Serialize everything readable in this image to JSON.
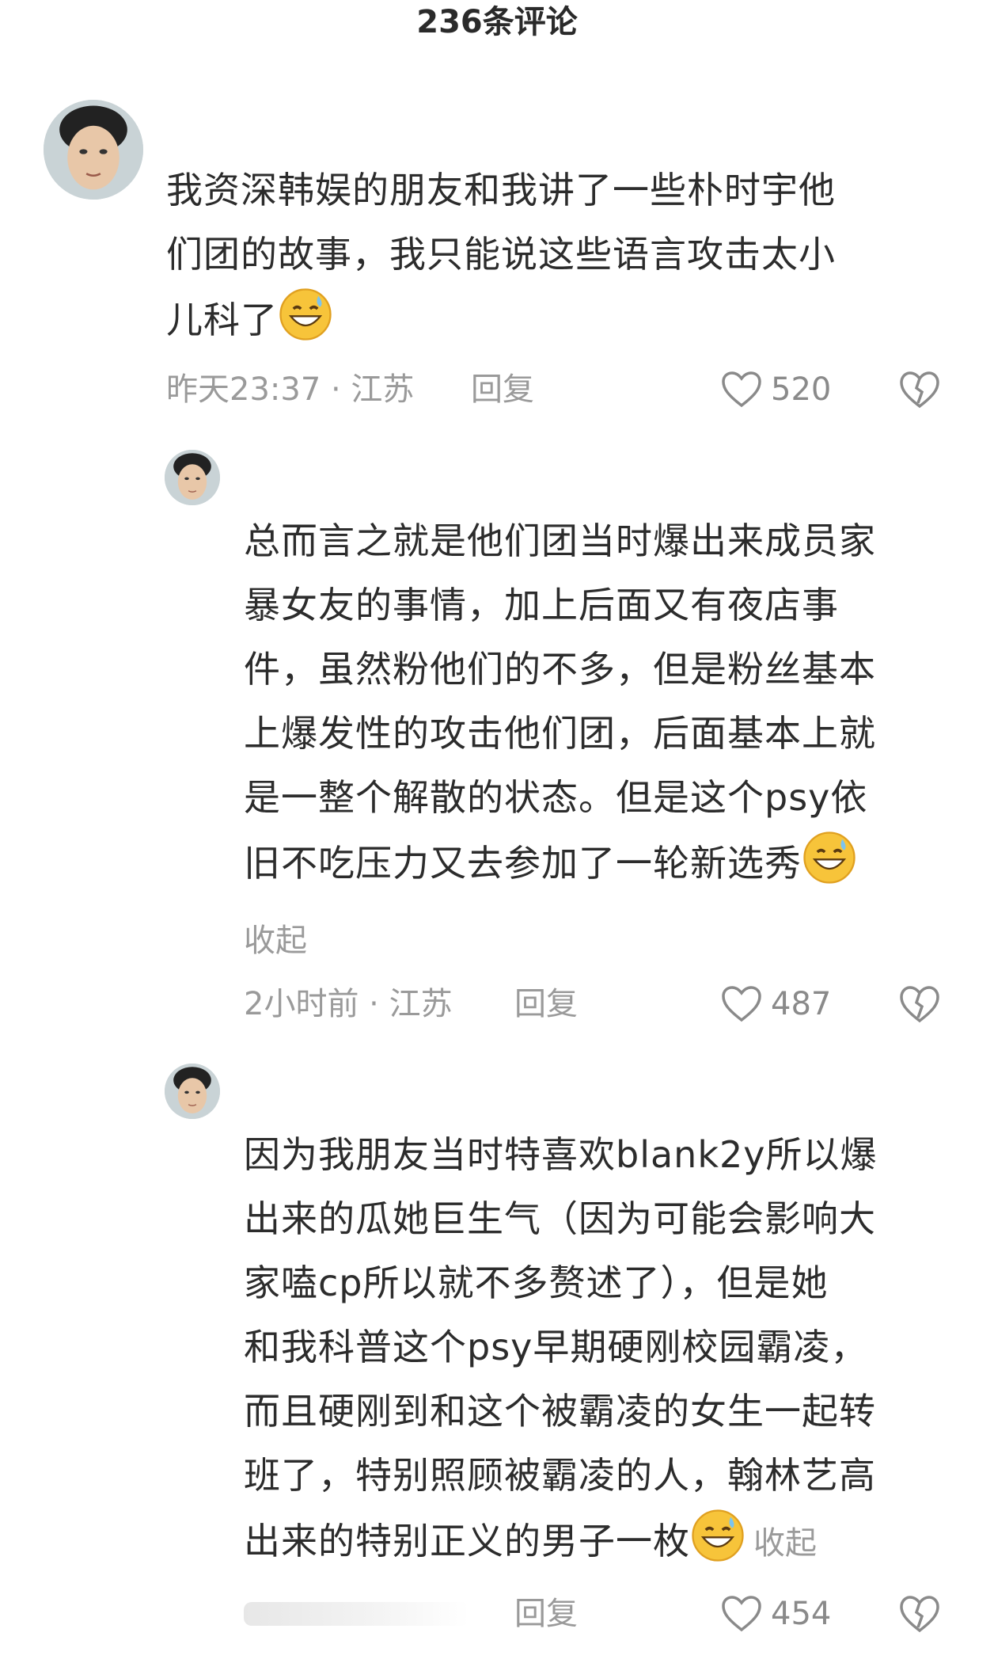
{
  "header": {
    "title": "236条评论"
  },
  "comments": [
    {
      "lines": [
        "我资深韩娱的朋友和我讲了一些朴时宇他",
        "们团的故事，我只能说这些语言攻击太小",
        "儿科了"
      ],
      "emoji": "grinning-sweat-emoji",
      "time_location": "昨天23:37 · 江苏",
      "reply": "回复",
      "likes": "520"
    },
    {
      "lines": [
        "总而言之就是他们团当时爆出来成员家",
        "暴女友的事情，加上后面又有夜店事",
        "件，虽然粉他们的不多，但是粉丝基本",
        "上爆发性的攻击他们团，后面基本上就",
        "是一整个解散的状态。但是这个psy依",
        "旧不吃压力又去参加了一轮新选秀"
      ],
      "emoji": "grinning-sweat-emoji",
      "collapse": "收起",
      "time_location": "2小时前 · 江苏",
      "reply": "回复",
      "likes": "487"
    },
    {
      "lines": [
        "因为我朋友当时特喜欢blank2y所以爆",
        "出来的瓜她巨生气（因为可能会影响大",
        "家嗑cp所以就不多赘述了），但是她",
        "和我科普这个psy早期硬刚校园霸凌，",
        "而且硬刚到和这个被霸凌的女生一起转",
        "班了，特别照顾被霸凌的人，翰林艺高",
        "出来的特别正义的男子一枚"
      ],
      "emoji": "grinning-sweat-emoji",
      "collapse": "收起",
      "reply": "回复",
      "likes": "454"
    }
  ],
  "colors": {
    "text": "#2c2c2c",
    "meta": "#9a9a9a",
    "background": "#ffffff"
  },
  "icons": {
    "like": "heart-outline-icon",
    "dislike": "broken-heart-icon"
  }
}
